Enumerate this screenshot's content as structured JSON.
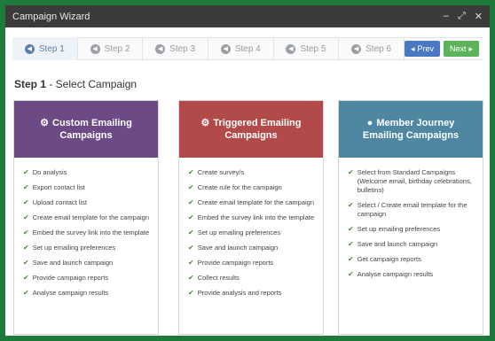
{
  "window": {
    "title": "Campaign Wizard",
    "controls": [
      "–",
      "⤢",
      "✕"
    ]
  },
  "steps": [
    {
      "label": "Step 1",
      "active": true
    },
    {
      "label": "Step 2",
      "active": false
    },
    {
      "label": "Step 3",
      "active": false
    },
    {
      "label": "Step 4",
      "active": false
    },
    {
      "label": "Step 5",
      "active": false
    },
    {
      "label": "Step 6",
      "active": false
    }
  ],
  "nav": {
    "prev_label": "Prev",
    "next_label": "Next"
  },
  "heading": {
    "step": "Step 1",
    "text": " - Select Campaign"
  },
  "colors": {
    "custom": "#6b4a86",
    "triggered": "#b24a4a",
    "journey": "#4f87a3",
    "prev": "#4a79c2",
    "next": "#5cb35c"
  },
  "cards": [
    {
      "title_line1": "Custom Emailing",
      "title_line2": "Campaigns",
      "icon": "gears-icon",
      "items": [
        "Do analysis",
        "Export contact list",
        "Upload contact list",
        "Create email template for the campaign",
        "Embed the survey link into the template",
        "Set up emailing preferences",
        "Save and launch campaign",
        "Provide campaign reports",
        "Analyse campaign results"
      ]
    },
    {
      "title_line1": "Triggered Emailing",
      "title_line2": "Campaigns",
      "icon": "gear-icon",
      "items": [
        "Create survey/s",
        "Create rule for the campaign",
        "Create email template for the campaign",
        "Embed the survey link into the template",
        "Set up emailing preferences",
        "Save and launch campaign",
        "Provide campaign reports",
        "Collect results",
        "Provide analysis and reports"
      ]
    },
    {
      "title_line1": "Member Journey",
      "title_line2": "Emailing Campaigns",
      "icon": "circle-icon",
      "items": [
        "Select from Standard Campaigns (Welcome email, birthday celebrations, bulletins)",
        "Select / Create email template for the campaign",
        "Set up emailing preferences",
        "Save and launch campaign",
        "Get campaign reports",
        "Analyse campaign results"
      ]
    }
  ]
}
